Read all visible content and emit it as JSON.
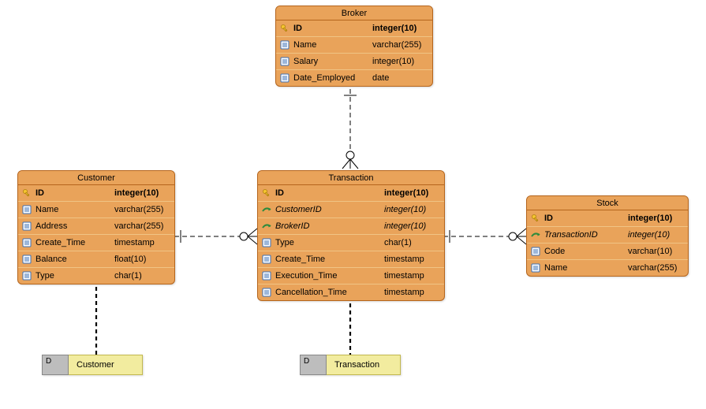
{
  "entities": {
    "broker": {
      "title": "Broker",
      "cols": [
        {
          "name": "ID",
          "type": "integer(10)",
          "kind": "pk"
        },
        {
          "name": "Name",
          "type": "varchar(255)",
          "kind": "col"
        },
        {
          "name": "Salary",
          "type": "integer(10)",
          "kind": "col"
        },
        {
          "name": "Date_Employed",
          "type": "date",
          "kind": "col"
        }
      ]
    },
    "customer": {
      "title": "Customer",
      "cols": [
        {
          "name": "ID",
          "type": "integer(10)",
          "kind": "pk"
        },
        {
          "name": "Name",
          "type": "varchar(255)",
          "kind": "col"
        },
        {
          "name": "Address",
          "type": "varchar(255)",
          "kind": "col"
        },
        {
          "name": "Create_Time",
          "type": "timestamp",
          "kind": "col"
        },
        {
          "name": "Balance",
          "type": "float(10)",
          "kind": "col"
        },
        {
          "name": "Type",
          "type": "char(1)",
          "kind": "col"
        }
      ]
    },
    "transaction": {
      "title": "Transaction",
      "cols": [
        {
          "name": "ID",
          "type": "integer(10)",
          "kind": "pk"
        },
        {
          "name": "CustomerID",
          "type": "integer(10)",
          "kind": "fk"
        },
        {
          "name": "BrokerID",
          "type": "integer(10)",
          "kind": "fk"
        },
        {
          "name": "Type",
          "type": "char(1)",
          "kind": "col"
        },
        {
          "name": "Create_Time",
          "type": "timestamp",
          "kind": "col"
        },
        {
          "name": "Execution_Time",
          "type": "timestamp",
          "kind": "col"
        },
        {
          "name": "Cancellation_Time",
          "type": "timestamp",
          "kind": "col"
        }
      ]
    },
    "stock": {
      "title": "Stock",
      "cols": [
        {
          "name": "ID",
          "type": "integer(10)",
          "kind": "pk"
        },
        {
          "name": "TransactionID",
          "type": "integer(10)",
          "kind": "fk"
        },
        {
          "name": "Code",
          "type": "varchar(10)",
          "kind": "col"
        },
        {
          "name": "Name",
          "type": "varchar(255)",
          "kind": "col"
        }
      ]
    }
  },
  "classrefs": {
    "customer_ref": {
      "tag": "D",
      "label": "Customer"
    },
    "transaction_ref": {
      "tag": "D",
      "label": "Transaction"
    }
  },
  "chart_data": {
    "type": "table",
    "diagram_type": "ERD",
    "entities": [
      {
        "name": "Broker",
        "primary_key": "ID",
        "columns": [
          {
            "name": "ID",
            "type": "integer(10)",
            "pk": true
          },
          {
            "name": "Name",
            "type": "varchar(255)"
          },
          {
            "name": "Salary",
            "type": "integer(10)"
          },
          {
            "name": "Date_Employed",
            "type": "date"
          }
        ]
      },
      {
        "name": "Customer",
        "primary_key": "ID",
        "columns": [
          {
            "name": "ID",
            "type": "integer(10)",
            "pk": true
          },
          {
            "name": "Name",
            "type": "varchar(255)"
          },
          {
            "name": "Address",
            "type": "varchar(255)"
          },
          {
            "name": "Create_Time",
            "type": "timestamp"
          },
          {
            "name": "Balance",
            "type": "float(10)"
          },
          {
            "name": "Type",
            "type": "char(1)"
          }
        ]
      },
      {
        "name": "Transaction",
        "primary_key": "ID",
        "columns": [
          {
            "name": "ID",
            "type": "integer(10)",
            "pk": true
          },
          {
            "name": "CustomerID",
            "type": "integer(10)",
            "fk": true
          },
          {
            "name": "BrokerID",
            "type": "integer(10)",
            "fk": true
          },
          {
            "name": "Type",
            "type": "char(1)"
          },
          {
            "name": "Create_Time",
            "type": "timestamp"
          },
          {
            "name": "Execution_Time",
            "type": "timestamp"
          },
          {
            "name": "Cancellation_Time",
            "type": "timestamp"
          }
        ]
      },
      {
        "name": "Stock",
        "primary_key": "ID",
        "columns": [
          {
            "name": "ID",
            "type": "integer(10)",
            "pk": true
          },
          {
            "name": "TransactionID",
            "type": "integer(10)",
            "fk": true
          },
          {
            "name": "Code",
            "type": "varchar(10)"
          },
          {
            "name": "Name",
            "type": "varchar(255)"
          }
        ]
      }
    ],
    "relationships": [
      {
        "from": "Broker",
        "to": "Transaction",
        "from_card": "one",
        "to_card": "zero-or-many",
        "style": "dashed"
      },
      {
        "from": "Customer",
        "to": "Transaction",
        "from_card": "one",
        "to_card": "zero-or-many",
        "style": "dashed"
      },
      {
        "from": "Transaction",
        "to": "Stock",
        "from_card": "one",
        "to_card": "zero-or-many",
        "style": "dashed"
      }
    ],
    "class_mappings": [
      {
        "entity": "Customer",
        "class": "Customer",
        "stereotype": "D"
      },
      {
        "entity": "Transaction",
        "class": "Transaction",
        "stereotype": "D"
      }
    ]
  }
}
